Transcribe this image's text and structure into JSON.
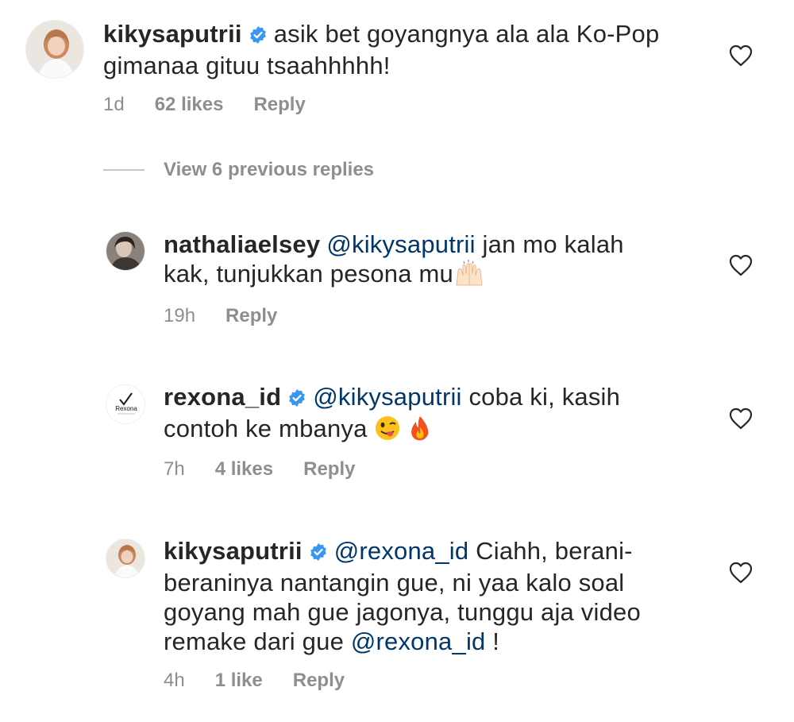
{
  "comments": [
    {
      "username": "kikysaputrii",
      "verified": true,
      "mention": "",
      "line1": "asik bet goyangnya ala ala Ko-Pop",
      "line2": "gimanaa gituu tsaahhhhh!",
      "time": "1d",
      "likes": "62 likes",
      "reply": "Reply"
    },
    {
      "username": "nathaliaelsey",
      "verified": false,
      "mention": "@kikysaputrii",
      "line1": "jan mo kalah",
      "line2": "kak, tunjukkan pesona mu",
      "emoji": "raising-hands",
      "time": "19h",
      "likes": "",
      "reply": "Reply"
    },
    {
      "username": "rexona_id",
      "verified": true,
      "mention": "@kikysaputrii",
      "line1": "coba ki, kasih",
      "line2": "contoh ke mbanya",
      "emoji": "winking-tongue, fire",
      "time": "7h",
      "likes": "4 likes",
      "reply": "Reply",
      "avatar_logo_text": "Rexona"
    },
    {
      "username": "kikysaputrii",
      "verified": true,
      "mention": "@rexona_id",
      "line1": "Ciahh, berani-",
      "line2": "beraninya nantangin gue, ni yaa kalo soal",
      "line3": "goyang mah gue jagonya, tunggu aja video",
      "line4a": "remake dari gue",
      "line4mention": "@rexona_id",
      "line4b": " !",
      "time": "4h",
      "likes": "1 like",
      "reply": "Reply"
    }
  ],
  "view_replies": "View 6 previous replies",
  "icons": {
    "like": "heart-outline-icon",
    "verified": "verified-badge-icon"
  },
  "colors": {
    "verified": "#3897f0",
    "mention": "#00376b",
    "secondary": "#8e8e8e"
  }
}
